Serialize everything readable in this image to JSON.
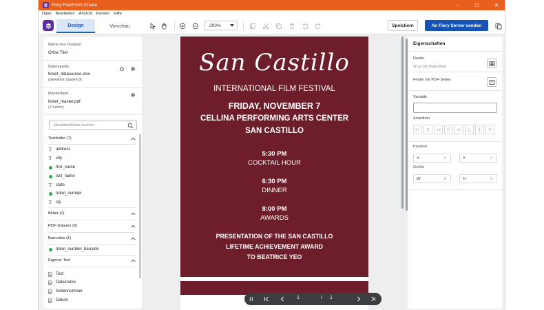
{
  "window": {
    "title": "Fiery FreeForm Create",
    "controls": [
      "–",
      "☐",
      "✕"
    ]
  },
  "menu": [
    "Datei",
    "Bearbeiten",
    "Ansicht",
    "Fenster",
    "Hilfe"
  ],
  "toolbar": {
    "tab_design": "Design",
    "tab_preview": "Vorschau",
    "zoom": "200%",
    "save_label": "Speichern",
    "send_label": "An Fiery Server senden"
  },
  "left_panel": {
    "design_name_label": "Name des Designs:",
    "design_name_value": "Ohne Titel",
    "datasource_label": "Datenquelle:",
    "datasource_file": "ticket_datasource.xlsx",
    "datasource_info": "(Gewählte Spalten 8)",
    "master_label": "Masterdatei:",
    "master_file": "ticket_master.pdf",
    "master_info": "(1 Seiten)",
    "search_placeholder": "Variablenfelder suchen",
    "textfields_header": "Textfelder (7)",
    "textfields": [
      {
        "name": "address",
        "kind": "text"
      },
      {
        "name": "city",
        "kind": "text"
      },
      {
        "name": "first_name",
        "kind": "used"
      },
      {
        "name": "last_name",
        "kind": "used"
      },
      {
        "name": "state",
        "kind": "text"
      },
      {
        "name": "ticket_number",
        "kind": "used"
      },
      {
        "name": "zip",
        "kind": "text"
      }
    ],
    "images_header": "Bilder (0)",
    "pdf_header": "PDF-Dateien (0)",
    "barcodes_header": "Barcodes (1)",
    "barcodes": [
      "ticket_number_barcode"
    ],
    "custom_header": "Eigener Text",
    "custom_items": [
      "Text",
      "Dateiname",
      "Seitennummer",
      "Datum"
    ]
  },
  "ticket": {
    "script_title": "San Castillo",
    "subtitle": "INTERNATIONAL FILM FESTIVAL",
    "date": "FRIDAY, NOVEMBER 7",
    "venue": "CELLINA PERFORMING ARTS CENTER",
    "city": "SAN CASTILLO",
    "t1": "5:30 PM",
    "e1": "COCKTAIL HOUR",
    "t2": "6:30 PM",
    "e2": "DINNER",
    "t3": "8:00 PM",
    "e3": "AWARDS",
    "p1": "PRESENTATION OF THE SAN CASTILLO",
    "p2": "LIFETIME ACHIEVEMENT AWARD",
    "p3": "TO BEATRICE YEO",
    "color": "#6e1e2a"
  },
  "pager": {
    "current": "1",
    "separator": "/",
    "total": "1"
  },
  "right_panel": {
    "header": "Eigenschaften",
    "raster_label": "Raster",
    "raster_info": "50 px pro Rasterlinie",
    "pdf_fields_label": "Felder mit PDF-Seiten",
    "variable_label": "Variable",
    "arrange_label": "Anordnen",
    "position_label": "Position",
    "x_label": "X",
    "x_value": "0",
    "y_label": "Y",
    "y_value": "0",
    "size_label": "Größe",
    "w_label": "W",
    "w_value": "0",
    "h_label": "H",
    "h_value": "0"
  },
  "colors": {
    "accent": "#1553b8",
    "titlebar": "#e85f1e",
    "brand": "#5b2d9c",
    "used_field": "#2ea84a"
  }
}
